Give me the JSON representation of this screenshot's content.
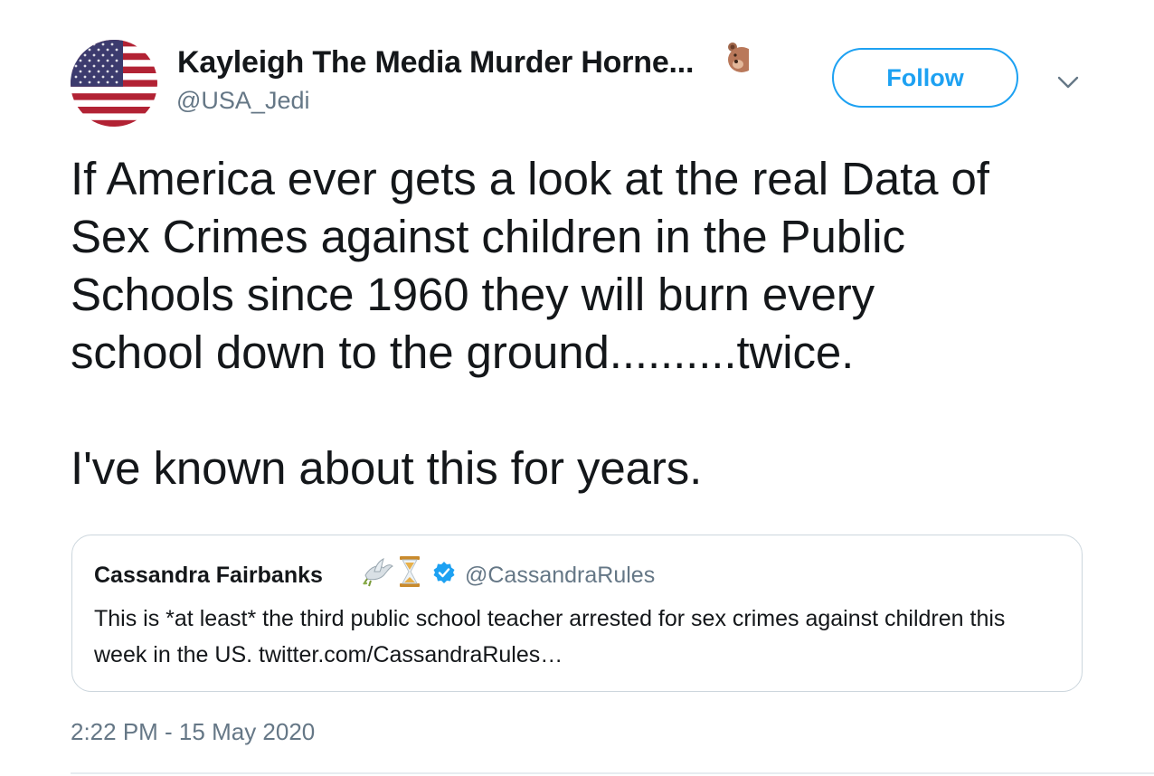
{
  "tweet": {
    "author": {
      "display_name": "Kayleigh The Media Murder Horne...",
      "name_emoji_icon": "bear-face-emoji",
      "handle": "@USA_Jedi",
      "avatar_icon": "us-flag-avatar"
    },
    "follow_label": "Follow",
    "caret_icon": "chevron-down-icon",
    "text": "If America ever gets a look at the real Data of\nSex Crimes against children in the Public\nSchools since 1960 they will burn every\nschool down to the ground..........twice.\n\nI've known about this for years.",
    "quoted_tweet": {
      "display_name": "Cassandra Fairbanks",
      "emojis": [
        "dove-emoji",
        "hourglass-emoji"
      ],
      "verified": true,
      "handle": "@CassandraRules",
      "text": "This is *at least* the third public school teacher arrested for sex crimes against children this week in the US. twitter.com/CassandraRules…"
    },
    "timestamp": "2:22 PM - 15 May 2020"
  },
  "colors": {
    "accent": "#1da1f2",
    "text_primary": "#14171a",
    "text_secondary": "#657786",
    "border": "#ccd6dd"
  }
}
